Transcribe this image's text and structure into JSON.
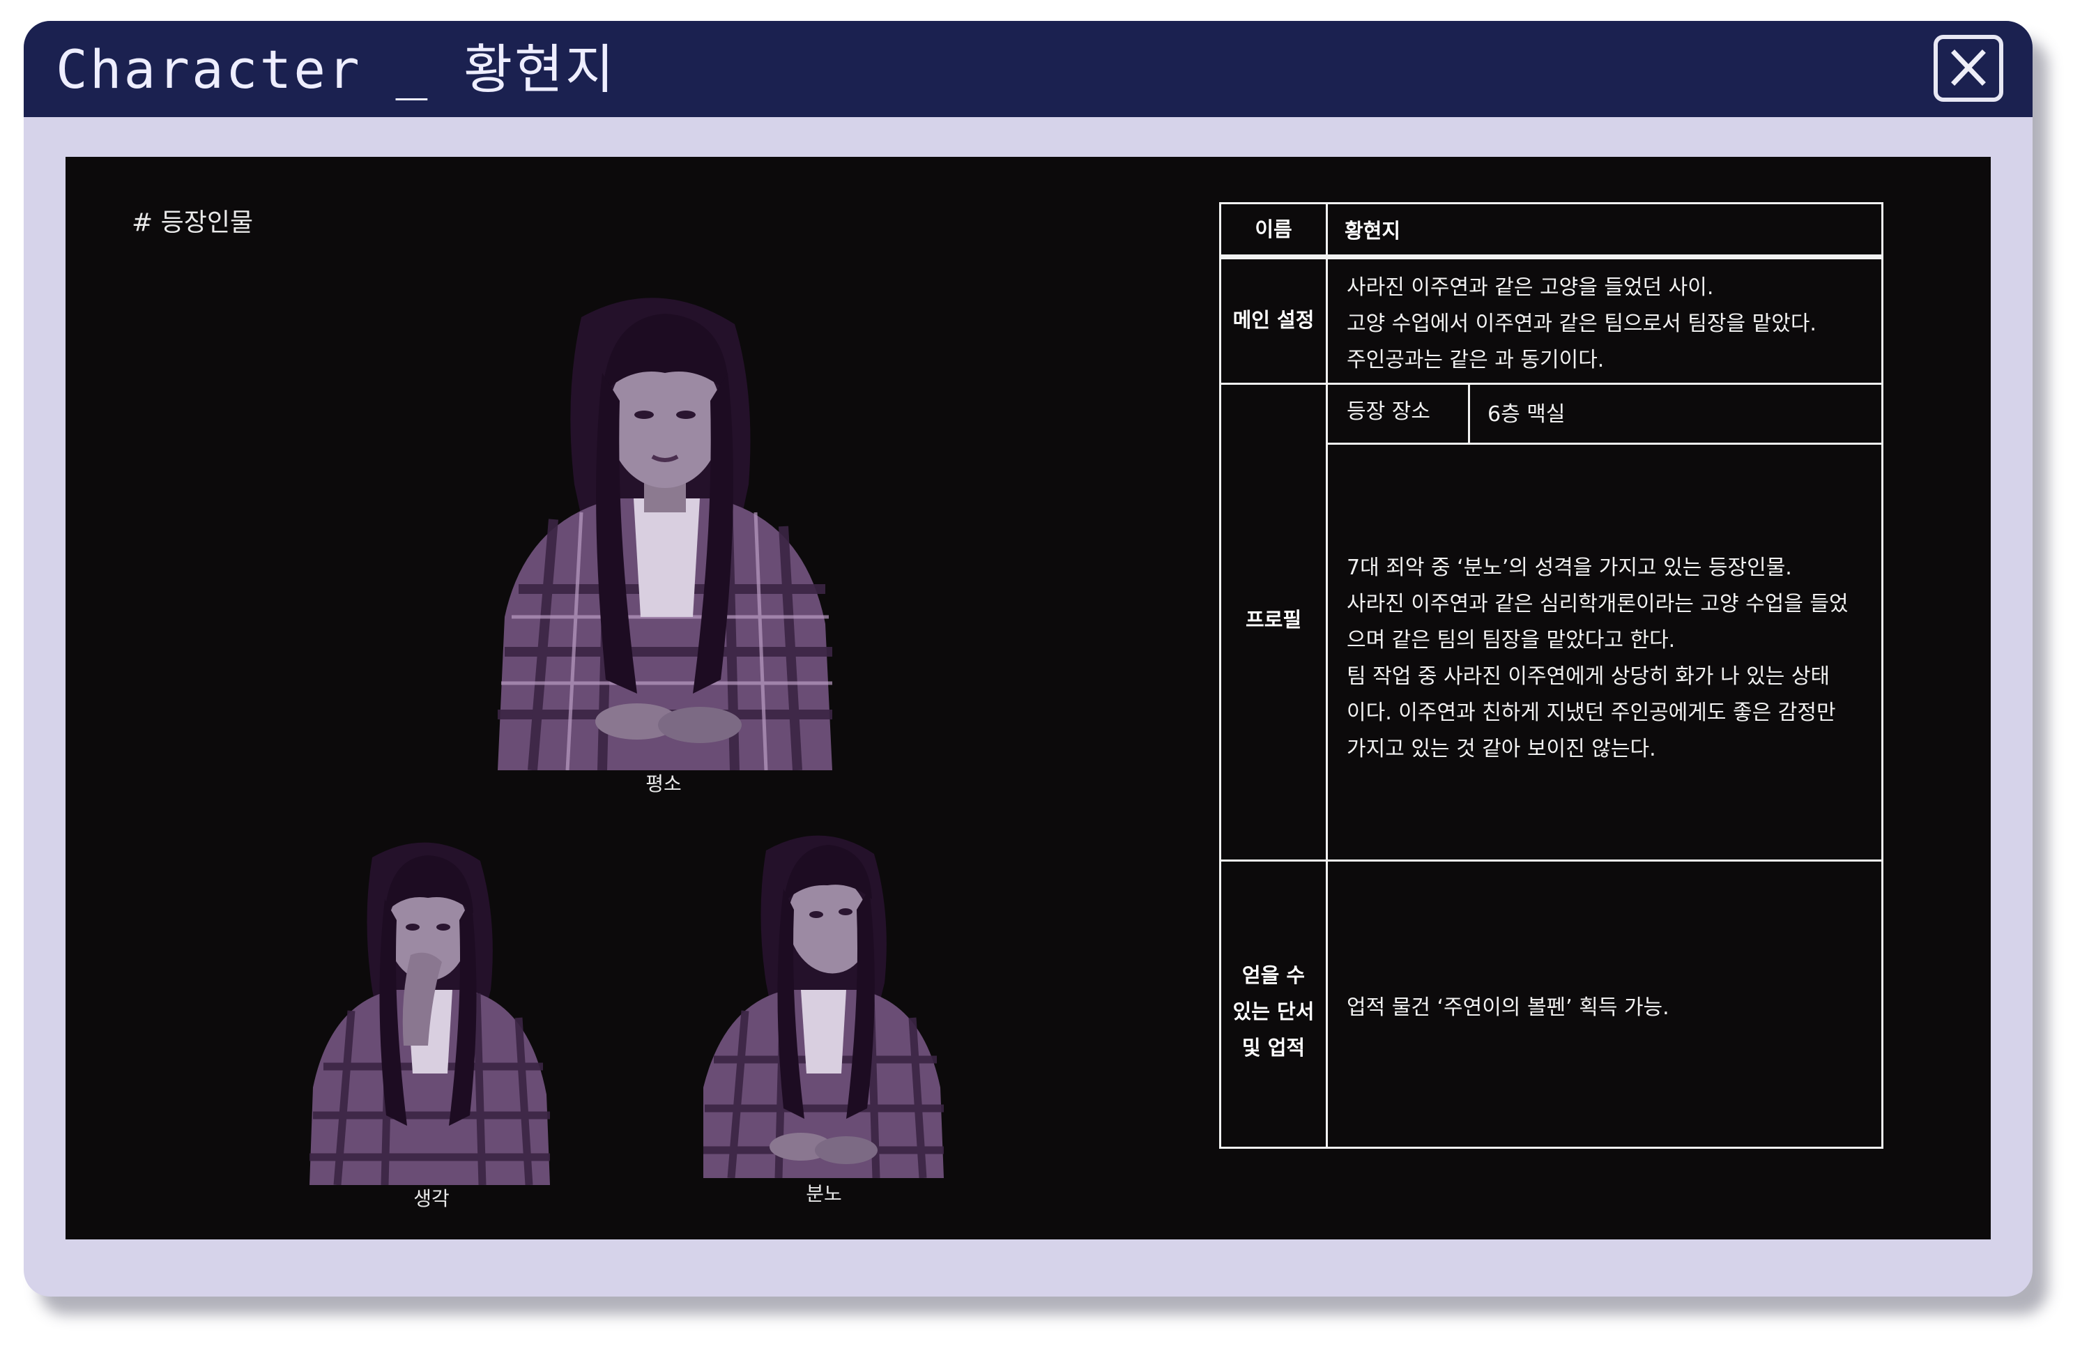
{
  "window": {
    "title": "Character _ 황현지",
    "close_icon": "close-x-icon"
  },
  "content": {
    "section_label": "# 등장인물",
    "portraits": [
      {
        "caption": "평소"
      },
      {
        "caption": "생각"
      },
      {
        "caption": "분노"
      }
    ],
    "table": {
      "name_header": "이름",
      "name_value": "황현지",
      "main_setting_header": "메인 설정",
      "main_setting_lines": [
        "사라진 이주연과 같은 고양을 들었던 사이.",
        "고양 수업에서 이주연과 같은 팀으로서 팀장을 맡았다.",
        "주인공과는 같은 과 동기이다."
      ],
      "profile_header": "프로필",
      "location_label": "등장 장소",
      "location_value": "6층 맥실",
      "profile_lines": [
        "7대 죄악 중 ‘분노’의 성격을 가지고 있는 등장인물.",
        "사라진 이주연과 같은 심리학개론이라는 고양 수업을 들었",
        "으며 같은 팀의 팀장을 맡았다고 한다.",
        "팀 작업 중 사라진 이주연에게 상당히 화가 나 있는 상태",
        "이다. 이주연과 친하게 지냈던 주인공에게도 좋은 감정만",
        "가지고 있는 것 같아 보이진 않는다."
      ],
      "clue_header_lines": [
        "얻을 수",
        "있는 단서",
        "및 업적"
      ],
      "clue_value": "업적 물건 ‘주연이의 볼펜’ 획득 가능."
    }
  },
  "colors": {
    "titlebar": "#1b2150",
    "frame": "#d6d3ea",
    "content_bg": "#0c0a0b",
    "text": "#f2f2f2"
  }
}
